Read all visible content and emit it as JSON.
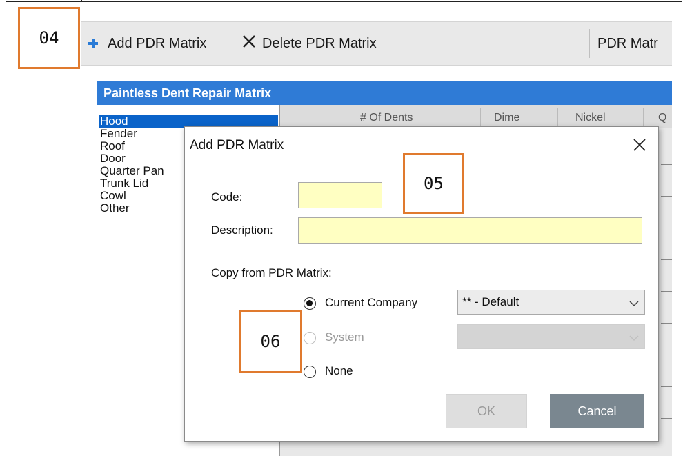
{
  "annotations": {
    "a04": "04",
    "a05": "05",
    "a06": "06"
  },
  "toolbar": {
    "add_label": "Add PDR Matrix",
    "delete_label": "Delete PDR Matrix",
    "pdr_label": "PDR Matr"
  },
  "matrix": {
    "title": "Paintless Dent Repair Matrix",
    "items": [
      "Hood",
      "Fender",
      "Roof",
      "Door",
      "Quarter Pan",
      "Trunk Lid",
      "Cowl",
      "Other"
    ],
    "selected": "Hood",
    "columns": [
      "# Of Dents",
      "Dime",
      "Nickel",
      "Q"
    ]
  },
  "dialog": {
    "title": "Add PDR Matrix",
    "code_label": "Code:",
    "code_value": "",
    "description_label": "Description:",
    "description_value": "",
    "copy_from_label": "Copy from PDR Matrix:",
    "options": [
      {
        "label": "Current Company",
        "checked": true,
        "enabled": true
      },
      {
        "label": "System",
        "checked": false,
        "enabled": false
      },
      {
        "label": "None",
        "checked": false,
        "enabled": true
      }
    ],
    "current_company_select": "** - Default",
    "system_select": "",
    "ok_label": "OK",
    "cancel_label": "Cancel"
  },
  "colors": {
    "accent": "#2f7bd6",
    "selection": "#0a63c9",
    "input_fill": "#ffffc2",
    "annotation": "#e07a2e"
  }
}
